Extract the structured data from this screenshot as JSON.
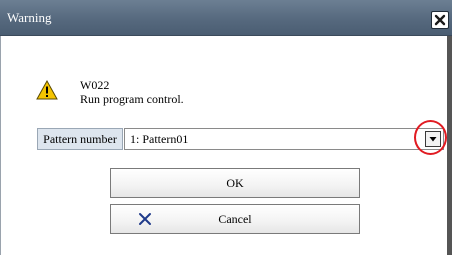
{
  "dialog": {
    "title": "Warning",
    "close_icon": "close-x-icon"
  },
  "message": {
    "icon": "warning-triangle-icon",
    "code": "W022",
    "text": "Run program control."
  },
  "pattern": {
    "label": "Pattern number",
    "selected": "1: Pattern01",
    "dropdown_icon": "dropdown-arrow-icon"
  },
  "buttons": {
    "ok_label": "OK",
    "cancel_label": "Cancel",
    "cancel_icon": "x-mark-icon"
  },
  "colors": {
    "title_bar": "#56697e",
    "annotation": "#e11b22",
    "warning_fill": "#f5c400",
    "cancel_icon": "#1f3a8a"
  }
}
